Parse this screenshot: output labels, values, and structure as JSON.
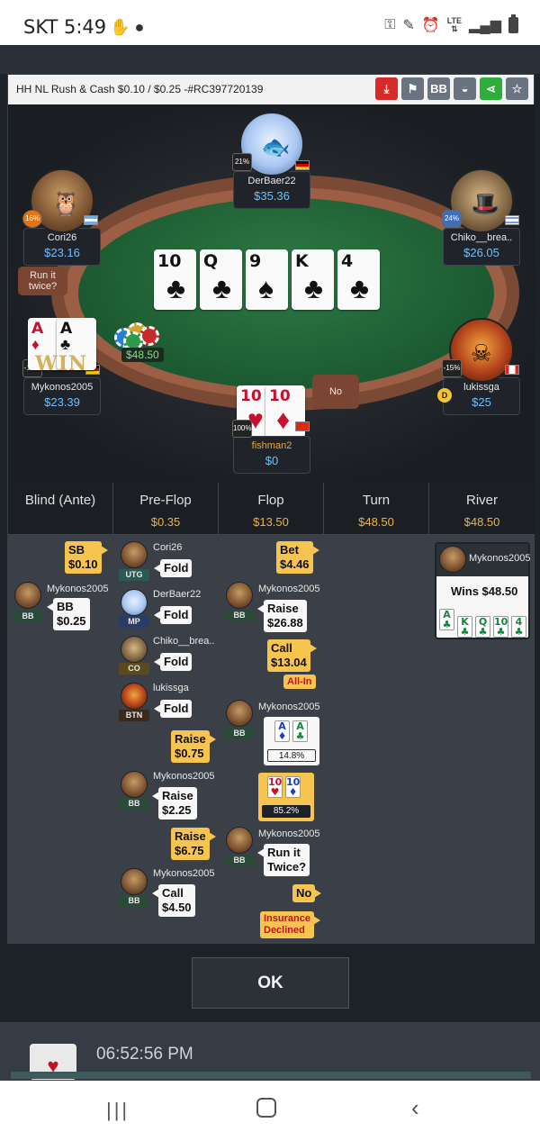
{
  "status_bar": {
    "time": "SKT 5:49",
    "left_icons": [
      "hand-wave-icon",
      "chat-bubble-icon"
    ],
    "right_icons": [
      "key-icon",
      "pencil-icon",
      "alarm-icon",
      "lte-icon",
      "signal-icon",
      "battery-icon"
    ],
    "lte_label": "LTE"
  },
  "modal": {
    "title": "HH NL Rush & Cash $0.10 / $0.25 -#RC397720139",
    "header_buttons": [
      {
        "icon": "download-icon",
        "color": "#d62b2b"
      },
      {
        "icon": "flag-icon",
        "color": "#6a7480"
      },
      {
        "icon": "bb-icon",
        "label": "BB",
        "color": "#6a7480"
      },
      {
        "icon": "incognito-icon",
        "color": "#6a7480"
      },
      {
        "icon": "share-icon",
        "color": "#2fae3c"
      },
      {
        "icon": "star-icon",
        "color": "#6a7480"
      }
    ]
  },
  "table": {
    "board": [
      {
        "rank": "10",
        "suit": "♣"
      },
      {
        "rank": "Q",
        "suit": "♣"
      },
      {
        "rank": "9",
        "suit": "♠"
      },
      {
        "rank": "K",
        "suit": "♣"
      },
      {
        "rank": "4",
        "suit": "♣"
      }
    ],
    "pot": "$48.50",
    "run_it_twice_bubble": "Run it twice?",
    "no_bubble": "No",
    "win_overlay": "WIN",
    "players": {
      "derbaer": {
        "name": "DerBaer22",
        "stack": "$35.36",
        "pct": "21%"
      },
      "cori": {
        "name": "Cori26",
        "stack": "$23.16",
        "pct": "16%"
      },
      "chiko": {
        "name": "Chiko__brea..",
        "stack": "$26.05",
        "pct": "24%"
      },
      "mykonos": {
        "name": "Mykonos2005",
        "stack": "$23.39",
        "pct": "-10%"
      },
      "lukissga": {
        "name": "lukissga",
        "stack": "$25",
        "pct": "-15%"
      },
      "fishman": {
        "name": "fishman2",
        "stack": "$0",
        "pct": "100%"
      }
    },
    "mykonos_cards": [
      {
        "rank": "A",
        "suit": "♦"
      },
      {
        "rank": "A",
        "suit": "♣"
      }
    ],
    "fishman_cards": [
      {
        "rank": "10",
        "suit": "♥"
      },
      {
        "rank": "10",
        "suit": "♦"
      }
    ],
    "dealer_label": "D"
  },
  "streets": {
    "headers": [
      {
        "title": "Blind (Ante)",
        "value": ""
      },
      {
        "title": "Pre-Flop",
        "value": "$0.35"
      },
      {
        "title": "Flop",
        "value": "$13.50"
      },
      {
        "title": "Turn",
        "value": "$48.50"
      },
      {
        "title": "River",
        "value": "$48.50"
      }
    ],
    "blind": {
      "sb": "SB\n$0.10",
      "sb_line1": "SB",
      "sb_line2": "$0.10",
      "bb_name": "Mykonos2005",
      "bb_pos": "BB",
      "bb_line1": "BB",
      "bb_line2": "$0.25"
    },
    "preflop": [
      {
        "name": "Cori26",
        "pos": "UTG",
        "action": "Fold"
      },
      {
        "name": "DerBaer22",
        "pos": "MP",
        "action": "Fold"
      },
      {
        "name": "Chiko__brea..",
        "pos": "CO",
        "action": "Fold"
      },
      {
        "name": "lukissga",
        "pos": "BTN",
        "action": "Fold"
      }
    ],
    "preflop_raise1": {
      "l1": "Raise",
      "l2": "$0.75"
    },
    "preflop_m1": {
      "name": "Mykonos2005",
      "pos": "BB",
      "l1": "Raise",
      "l2": "$2.25"
    },
    "preflop_raise2": {
      "l1": "Raise",
      "l2": "$6.75"
    },
    "preflop_m2": {
      "name": "Mykonos2005",
      "pos": "BB",
      "l1": "Call",
      "l2": "$4.50"
    },
    "flop": {
      "bet": {
        "l1": "Bet",
        "l2": "$4.46"
      },
      "m_raise": {
        "name": "Mykonos2005",
        "pos": "BB",
        "l1": "Raise",
        "l2": "$26.88"
      },
      "call": {
        "l1": "Call",
        "l2": "$13.04"
      },
      "allin": "All-In",
      "m_equity": {
        "name": "Mykonos2005",
        "pos": "BB",
        "pct": "14.8%",
        "cards": [
          {
            "rank": "A",
            "suit": "♦"
          },
          {
            "rank": "A",
            "suit": "♣"
          }
        ]
      },
      "opp_equity": {
        "pct": "85.2%",
        "cards": [
          {
            "rank": "10",
            "suit": "♥"
          },
          {
            "rank": "10",
            "suit": "♦"
          }
        ]
      },
      "m_rit": {
        "name": "Mykonos2005",
        "pos": "BB",
        "l1": "Run it",
        "l2": "Twice?"
      },
      "no": "No",
      "insurance": {
        "l1": "Insurance",
        "l2": "Declined"
      }
    },
    "river": {
      "winner": "Mykonos2005",
      "wins": "Wins $48.50",
      "cards": [
        {
          "rank": "A",
          "suit": "♣"
        },
        {
          "rank": "K",
          "suit": "♣"
        },
        {
          "rank": "Q",
          "suit": "♣"
        },
        {
          "rank": "10",
          "suit": "♣"
        },
        {
          "rank": "4",
          "suit": "♣"
        }
      ]
    }
  },
  "ok_button": "OK",
  "background": {
    "time": "06:52:56 PM",
    "card_suit": "♥"
  }
}
